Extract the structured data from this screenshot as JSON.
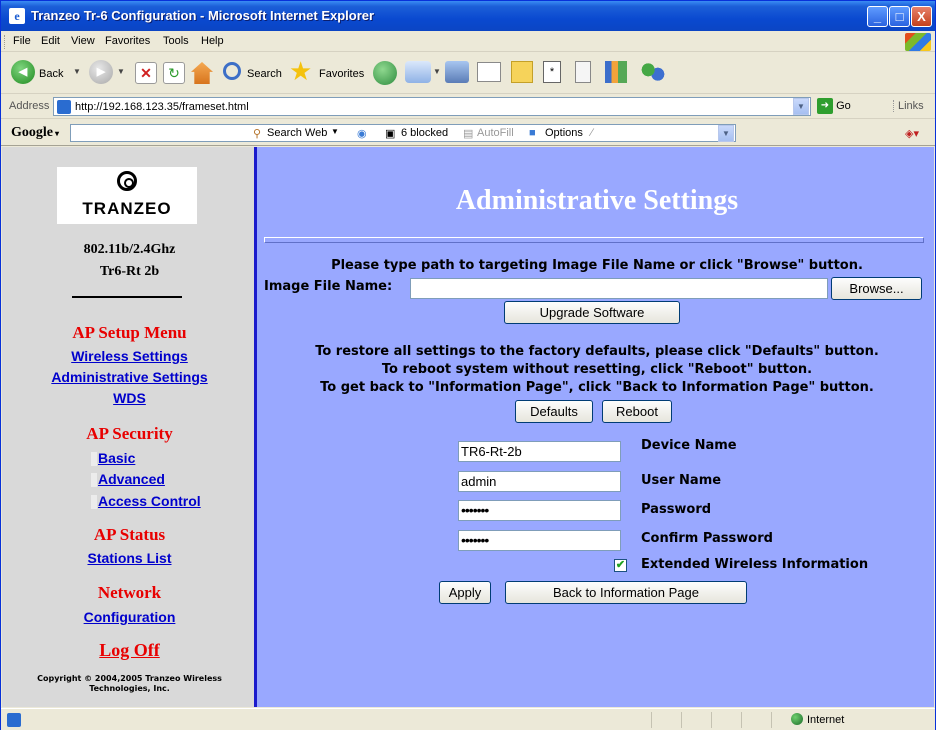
{
  "window": {
    "title": "Tranzeo Tr-6 Configuration - Microsoft Internet Explorer",
    "minimize": "_",
    "maximize": "□",
    "close": "X"
  },
  "menu": {
    "items": [
      "File",
      "Edit",
      "View",
      "Favorites",
      "Tools",
      "Help"
    ]
  },
  "toolbar": {
    "back_label": "Back",
    "search_label": "Search",
    "favorites_label": "Favorites"
  },
  "address": {
    "label": "Address",
    "url": "http://192.168.123.35/frameset.html",
    "go_label": "Go",
    "links_label": "Links"
  },
  "google_bar": {
    "logo": "Google",
    "search_web": "Search Web",
    "blocked": "6 blocked",
    "autofill": "AutoFill",
    "options": "Options"
  },
  "sidebar": {
    "logo_text": "TRANZEO",
    "model_line1": "802.11b/2.4Ghz",
    "model_line2": "Tr6-Rt 2b",
    "ap_setup_menu": "AP Setup Menu",
    "wireless_settings": "Wireless Settings",
    "administrative_settings": "Administrative Settings",
    "wds": "WDS",
    "ap_security": "AP Security",
    "basic": "Basic",
    "advanced": "Advanced",
    "access_control": "Access Control",
    "ap_status": "AP Status",
    "stations_list": "Stations List",
    "network": "Network",
    "configuration": "Configuration",
    "log_off": "Log Off",
    "copyright_line1": "Copyright © 2004,2005 Tranzeo Wireless",
    "copyright_line2": "Technologies, Inc."
  },
  "main": {
    "title": "Administrative Settings",
    "upgrade_instruction": "Please type path to targeting Image File Name or click \"Browse\" button.",
    "image_file_label": "Image File Name:",
    "image_file_value": "",
    "browse_label": "Browse...",
    "upgrade_label": "Upgrade Software",
    "restore_line1": "To restore all settings to the factory defaults, please click \"Defaults\" button.",
    "restore_line2": "To reboot system without resetting, click \"Reboot\" button.",
    "restore_line3": "To get back to \"Information Page\", click \"Back to Information Page\" button.",
    "defaults_label": "Defaults",
    "reboot_label": "Reboot",
    "device_name_value": "TR6-Rt-2b",
    "device_name_label": "Device Name",
    "user_name_value": "admin",
    "user_name_label": "User Name",
    "password_value": "•••••••",
    "password_label": "Password",
    "confirm_password_value": "•••••••",
    "confirm_password_label": "Confirm Password",
    "extended_checked": "✔",
    "extended_label": "Extended Wireless Information",
    "apply_label": "Apply",
    "back_info_label": "Back to Information Page"
  },
  "status": {
    "zone": "Internet"
  },
  "colors": {
    "content_bg": "#99a8ff",
    "sidebar_bg": "#d9d9d9",
    "section_red": "#e80000",
    "link_blue": "#0000cc"
  }
}
